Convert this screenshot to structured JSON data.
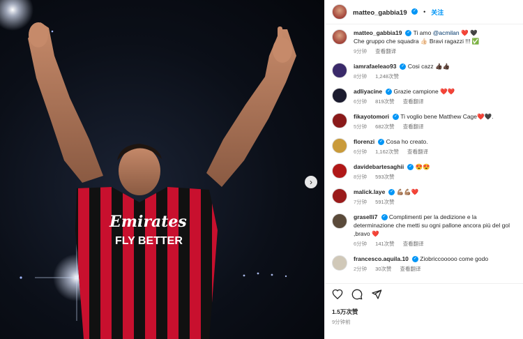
{
  "post": {
    "username": "matteo_gabbia19",
    "follow_label": "关注",
    "dot": "•",
    "caption": {
      "prefix": "Ti amo",
      "mention": "@acmilan",
      "emoji": "❤️ 🖤",
      "line2": "Che gruppo che squadra 👍🏻 Bravi ragazzi !!! ✅",
      "time": "9分钟",
      "translate": "查看翻译"
    },
    "likes": "1.5万次赞",
    "time": "9分钟前"
  },
  "comments": [
    {
      "user": "iamrafaeleao93",
      "text": "Cosi cazz 👍🏿👍🏿",
      "time": "8分钟",
      "likes": "1,248次赞",
      "avatar_color": "#3a2a6a"
    },
    {
      "user": "adliyacine",
      "text": "Grazie campione ❤️❤️",
      "time": "6分钟",
      "likes": "819次赞",
      "translate": "查看翻译",
      "avatar_color": "#1b1b2e"
    },
    {
      "user": "fikayotomori",
      "text": "Ti voglio bene Matthew Cage❤️🖤.",
      "time": "5分钟",
      "likes": "682次赞",
      "translate": "查看翻译",
      "avatar_color": "#8a1a1a"
    },
    {
      "user": "florenzi",
      "text": "Cosa ho creato.",
      "time": "6分钟",
      "likes": "1,162次赞",
      "translate": "查看翻译",
      "avatar_color": "#c99a3a"
    },
    {
      "user": "davidebartesaghii",
      "text": "😍😍",
      "time": "8分钟",
      "likes": "593次赞",
      "avatar_color": "#b01818"
    },
    {
      "user": "malick.laye",
      "text": "💪🏽💪🏽❤️",
      "time": "7分钟",
      "likes": "591次赞",
      "avatar_color": "#9a1b1b"
    },
    {
      "user": "graselli7",
      "text": "Complimenti per la dedizione e la determinazione che metti su ogni pallone ancora più del gol ,bravo ❤️",
      "time": "6分钟",
      "likes": "141次赞",
      "translate": "查看翻译",
      "avatar_color": "#5a4a3a"
    },
    {
      "user": "francesco.aquila.10",
      "text": "Ziobriccooooo come godo",
      "time": "2分钟",
      "likes": "30次赞",
      "translate": "查看翻译",
      "avatar_color": "#d0c8b8"
    }
  ],
  "colors": {
    "brand_blue": "#0095f6",
    "milan_red": "#c8102e",
    "heart_red": "#ed4956"
  },
  "icons": [
    "heart-icon",
    "comment-icon",
    "share-icon",
    "next-arrow-icon",
    "verified-badge-icon"
  ]
}
